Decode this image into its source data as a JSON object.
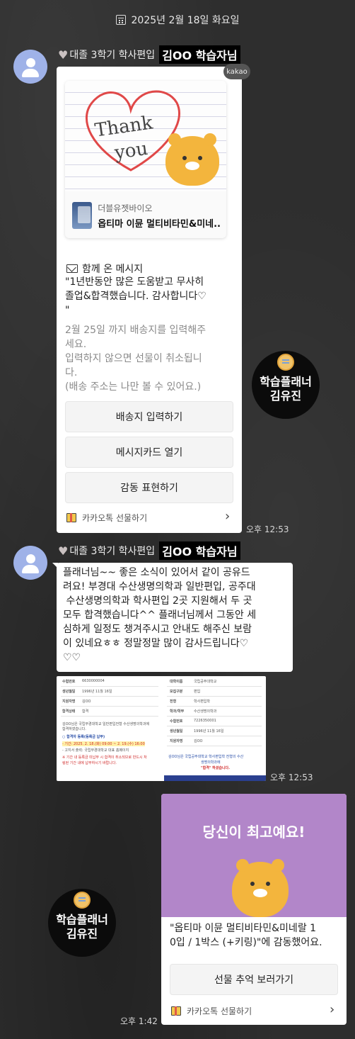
{
  "date_header": "2025년 2월 18일 화요일",
  "messages": {
    "first": {
      "sender_prefix": "대졸 3학기 학사편입",
      "sender_highlight": "김OO 학습자님",
      "kakao_badge": "kakao",
      "thank_line1": "Thank",
      "thank_line2": "you",
      "product_brand": "더블유젯바이오",
      "product_name": "옵티마 이뮨 멀티비타민&미네..",
      "with_message_label": "함께 온 메시지",
      "message_line1": "\"1년반동안 많은 도움받고 무사히",
      "message_line2": "졸업&합격했습니다. 감사합니다♡",
      "message_line3": "\"",
      "deadline_line1": "2월 25일 까지 배송지를 입력해주",
      "deadline_line2": "세요.",
      "deadline_line3": "입력하지 않으면 선물이 취소됩니",
      "deadline_line4": "다.",
      "deadline_line5": "(배송 주소는 나만 볼 수 있어요.)",
      "buttons": [
        "배송지 입력하기",
        "메시지카드 열기",
        "감동 표현하기"
      ],
      "footer": "카카오톡 선물하기",
      "time": "오후 12:53"
    },
    "second": {
      "sender_prefix": "대졸 3학기 학사편입",
      "sender_highlight": "김OO 학습자님",
      "text_lines": [
        "플래너님~~ 좋은 소식이 있어서 같이 공유드",
        "려요! 부경대 수산생명의학과 일반편입, 공주대",
        " 수산생명의학과 학사편입 2곳 지원해서 두 곳",
        "모두 합격했습니다^^ 플래너님께서 그동안 세",
        "심하게 일정도 챙겨주시고 안내도 해주신 보람",
        "이 있네요ㅎㅎ 정말정말 많이 감사드립니다♡",
        "♡♡"
      ],
      "time": "오후 12:53"
    },
    "doc_image": {
      "left_rows": [
        [
          "수험번호",
          "6630000004"
        ],
        [
          "생년월일",
          "1996년 11월 16일"
        ],
        [
          "지원자명",
          "김OO"
        ],
        [
          "합격상태",
          "합격"
        ]
      ],
      "left_note1": "김OO님은 국립부경대학교 일반편입전형 수산생명의학과에",
      "left_note2": "합격하였습니다.",
      "left_section": "○ 합격자 등록(등록금 납부)",
      "left_period": "- 기간: 2025. 2. 18.(화) 09:00 ~ 2. 19.(수) 16:00",
      "left_detail": "- 고지서 출력: 국립부경대학교 대표 홈페이지",
      "left_warn1": "※ 기간 내 등록금 미납부 시 합격이 취소되므로 반드시 처",
      "left_warn2": "링된 기간 내에 납부하시기 바랍니다.",
      "right_rows": [
        [
          "대학이름",
          "국립공주대학교"
        ],
        [
          "모집구분",
          "편입"
        ],
        [
          "전형",
          "학사편입학"
        ],
        [
          "학과/학부",
          "수산생명의학과"
        ],
        [
          "수험번호",
          "7226350001"
        ],
        [
          "생년월일",
          "1996년 11월 16일"
        ],
        [
          "지원자명",
          "김OO"
        ]
      ],
      "right_note1": "김OO님은 국립공주대학교 학사편입학 전형의 수산",
      "right_note2": "생명의학과에",
      "right_note3": "\"합격\" 하셨습니다.",
      "time": "오후 12:53"
    },
    "third": {
      "card_title": "당신이 최고예요!",
      "text_line1": "\"옵티마 이뮨 멀티비타민&미네랄 1",
      "text_line2": "0입 / 1박스 (+키링)\"에 감동했어요.",
      "button": "선물 추억 보러가기",
      "footer": "카카오톡 선물하기",
      "time": "오후 1:42"
    }
  },
  "planner_badge": {
    "line1": "학습플래너",
    "line2": "김유진"
  },
  "colors": {
    "background": "#2e2e2e",
    "bubble": "#ffffff",
    "avatar": "#9fb2e8",
    "purple_card": "#b286c9",
    "bear": "#f3b53d"
  }
}
